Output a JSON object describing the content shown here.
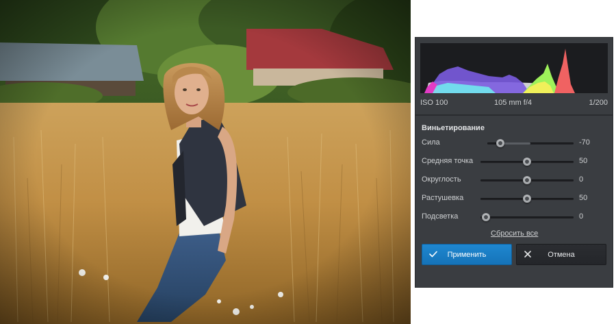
{
  "photo": {
    "subject": "woman-in-wheat-field"
  },
  "histogram": {
    "iso": "ISO 100",
    "lens": "105 mm f/4",
    "shutter": "1/200"
  },
  "vignette": {
    "title": "Виньетирование",
    "sliders": [
      {
        "label": "Сила",
        "value": "-70",
        "level": 0.15
      },
      {
        "label": "Средняя точка",
        "value": "50",
        "level": 0.5
      },
      {
        "label": "Округлость",
        "value": "0",
        "level": 0.5
      },
      {
        "label": "Растушевка",
        "value": "50",
        "level": 0.5
      },
      {
        "label": "Подсветка",
        "value": "0",
        "level": 0.0
      }
    ],
    "reset_label": "Сбросить все"
  },
  "buttons": {
    "apply_label": "Применить",
    "cancel_label": "Отмена",
    "apply_icon": "check-icon",
    "cancel_icon": "close-icon"
  },
  "colors": {
    "panel_bg": "#3a3d41",
    "histogram_bg": "#1b1c1f",
    "accent_blue": "#1a7cc3"
  }
}
